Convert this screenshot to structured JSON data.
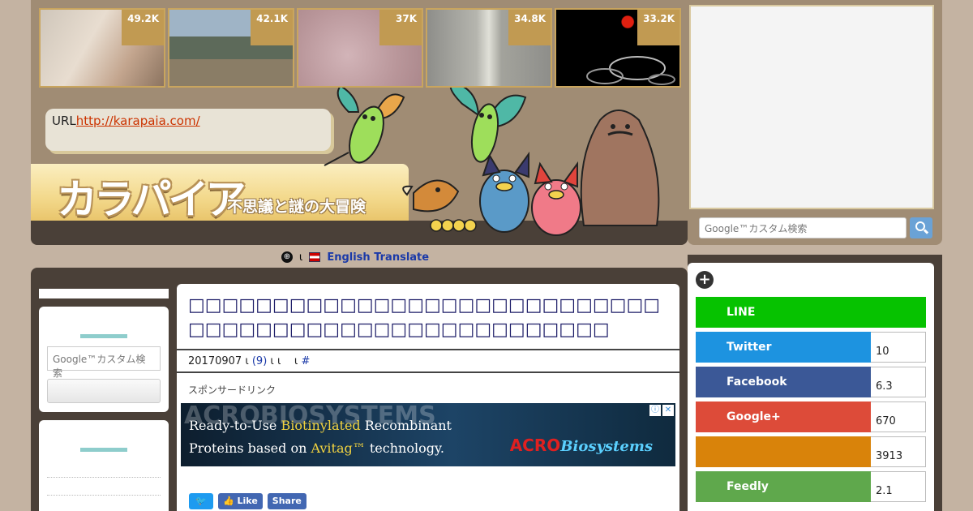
{
  "thumbnails": [
    {
      "count": "49.2K",
      "color_a": "#d8cfc4",
      "color_b": "#b9a996"
    },
    {
      "count": "42.1K",
      "color_a": "#8aa3b8",
      "color_b": "#6a6a4c"
    },
    {
      "count": "37K",
      "color_a": "#c9a9ad",
      "color_b": "#b39296"
    },
    {
      "count": "34.8K",
      "color_a": "#9a9a96",
      "color_b": "#d4d4cc"
    },
    {
      "count": "33.2K",
      "color_a": "#000000",
      "color_b": "#1c1c1c"
    }
  ],
  "site": {
    "url_label": "URL",
    "url": "http://karapaia.com/",
    "logo": "カラパイア",
    "tagline": "不思議と謎の大冒険"
  },
  "translate_bar": {
    "sep": "ι",
    "link": "English Translate"
  },
  "sidebar": {
    "search_placeholder": "Google™カスタム検索"
  },
  "article": {
    "title": "□□□□□□□□□□□□□□□□□□□□□□□□□□□□□□□□□□□□□□□□□□□□□□□□□□□□□",
    "date": "20170907",
    "sep1": "ι",
    "comments": "(9)",
    "sep2": "ι ι",
    "sep3": "ι",
    "hash": "#",
    "sponsor": "スポンサードリンク"
  },
  "ad": {
    "bg_text": "ACROBIOSYSTEMS",
    "line1_pre": "Ready-to-Use ",
    "line1_hl": "Biotinylated",
    "line1_post": " Recombinant",
    "line2_pre": "Proteins based on ",
    "line2_hl": "Avitag™",
    "line2_post": " technology.",
    "brand_acro": "ACRO",
    "brand_bio": "Biosystems",
    "info_icon": "ⓘ",
    "close_icon": "✕"
  },
  "share_buttons": {
    "twitter_icon": "🐦",
    "like": "👍 Like",
    "share": "Share"
  },
  "right": {
    "search_placeholder": "Google™カスタム検索",
    "plus": "+",
    "rows": [
      {
        "label": "LINE",
        "count": "",
        "color": "#06c200"
      },
      {
        "label": "Twitter",
        "count": "10",
        "color": "#1d93e0"
      },
      {
        "label": "Facebook",
        "count": "6.3",
        "color": "#3b5897"
      },
      {
        "label": "Google+",
        "count": "670",
        "color": "#dd4b39"
      },
      {
        "label": "",
        "count": "3913",
        "color": "#d9830a"
      },
      {
        "label": "Feedly",
        "count": "2.1",
        "color": "#5fa84c"
      }
    ]
  }
}
